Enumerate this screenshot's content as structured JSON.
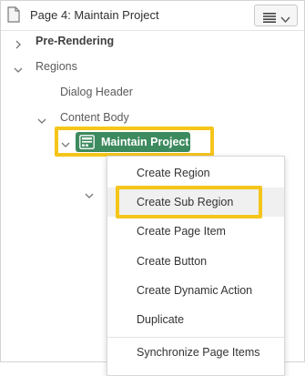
{
  "header": {
    "title": "Page 4: Maintain Project",
    "page_icon": "page-icon",
    "menu_icon": "hamburger-icon"
  },
  "tree": {
    "items": [
      {
        "label": "Pre-Rendering",
        "toggle": "chevron-right"
      },
      {
        "label": "Regions",
        "toggle": "chevron-down"
      },
      {
        "label": "Dialog Header"
      },
      {
        "label": "Content Body",
        "toggle": "chevron-down"
      },
      {
        "label": "Maintain Project",
        "toggle": "chevron-down",
        "selected": true,
        "icon": "region-icon"
      }
    ]
  },
  "context_menu": {
    "items": [
      {
        "label": "Create Region"
      },
      {
        "label": "Create Sub Region",
        "highlighted": true
      },
      {
        "label": "Create Page Item"
      },
      {
        "label": "Create Button"
      },
      {
        "label": "Create Dynamic Action"
      },
      {
        "label": "Duplicate"
      },
      {
        "label": "Synchronize Page Items"
      }
    ]
  },
  "colors": {
    "selected_node": "#3d8a5e",
    "highlight": "#f5c51a"
  }
}
